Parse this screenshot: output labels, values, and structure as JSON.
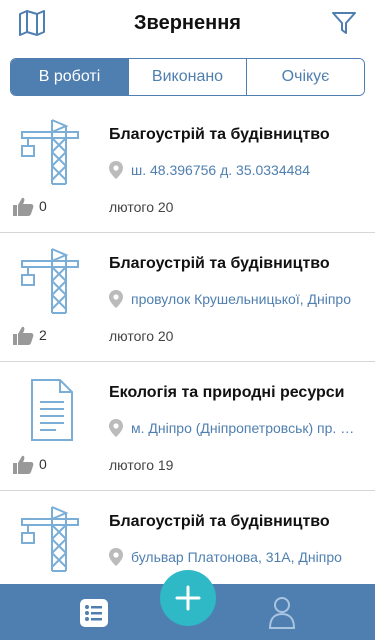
{
  "header": {
    "title": "Звернення",
    "map_icon": "map-icon",
    "filter_icon": "filter-icon"
  },
  "tabs": [
    {
      "label": "В роботі",
      "selected": true
    },
    {
      "label": "Виконано",
      "selected": false
    },
    {
      "label": "Очікує",
      "selected": false
    }
  ],
  "items": [
    {
      "icon": "crane-icon",
      "category": "Благоустрій та будівництво",
      "location": "ш. 48.396756 д. 35.0334484",
      "date": "лютого 20",
      "likes": "0"
    },
    {
      "icon": "crane-icon",
      "category": "Благоустрій та будівництво",
      "location": "провулок Крушельницької, Дніпро",
      "date": "лютого 20",
      "likes": "2"
    },
    {
      "icon": "document-icon",
      "category": "Екологія та природні ресурси",
      "location": "м. Дніпро (Дніпропетровськ) пр. Гагаріна",
      "date": "лютого 19",
      "likes": "0"
    },
    {
      "icon": "crane-icon",
      "category": "Благоустрій та будівництво",
      "location": "бульвар Платонова, 31А, Дніпро",
      "date": "",
      "likes": ""
    }
  ],
  "tabbar": {
    "list_icon": "list-icon",
    "add_icon": "plus-icon",
    "profile_icon": "profile-icon"
  },
  "colors": {
    "accent": "#4f7fb0",
    "fab": "#2fb8c6",
    "icon": "#7aaed6"
  }
}
